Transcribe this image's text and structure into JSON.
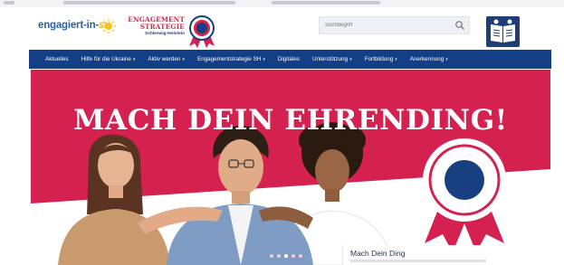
{
  "header": {
    "brand_main": "engagiert-in-",
    "brand_suffix": "SH",
    "strategy_line1": "ENGAGEMENT",
    "strategy_line2": "STRATEGIE",
    "strategy_line3": "Schleswig-Holstein"
  },
  "search": {
    "placeholder": "Suchbegriff",
    "icon": "magnifier-icon"
  },
  "accessibility": {
    "icon": "leichte-sprache-icon"
  },
  "nav": {
    "items": [
      {
        "label": "Aktuelles",
        "dropdown": false
      },
      {
        "label": "Hilfe für die Ukraine",
        "dropdown": true
      },
      {
        "label": "Aktiv werden",
        "dropdown": true
      },
      {
        "label": "Engagementstrategie SH",
        "dropdown": true
      },
      {
        "label": "Digitales",
        "dropdown": false
      },
      {
        "label": "Unterstützung",
        "dropdown": true
      },
      {
        "label": "Fortbildung",
        "dropdown": true
      },
      {
        "label": "Anerkennung",
        "dropdown": true
      }
    ]
  },
  "hero": {
    "headline": "MACH DEIN EHRENDING!",
    "card_title": "Mach Dein Ding",
    "slide_count": 5,
    "active_slide": 3
  },
  "colors": {
    "brand_navy": "#133f86",
    "hero_red": "#d42150",
    "rosette_blue": "#183f80"
  }
}
